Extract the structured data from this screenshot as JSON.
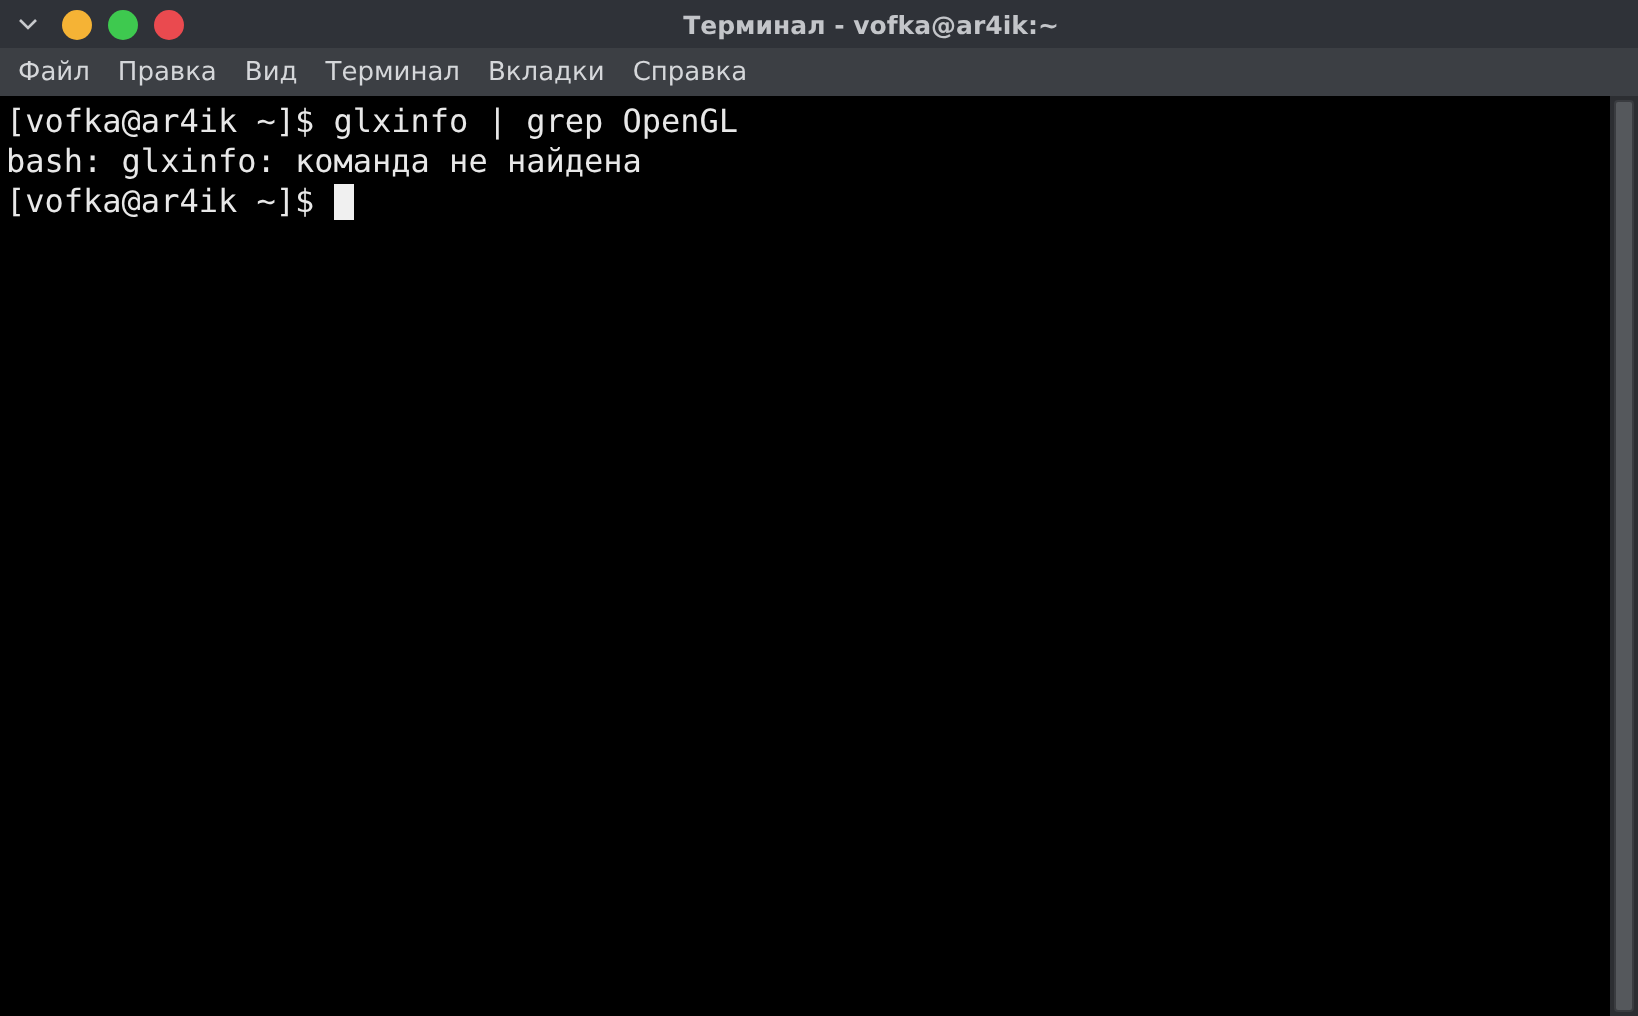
{
  "window": {
    "title": "Терминал - vofka@ar4ik:~"
  },
  "menu": [
    "Файл",
    "Правка",
    "Вид",
    "Терминал",
    "Вкладки",
    "Справка"
  ],
  "terminal": {
    "lines": [
      {
        "text": "[vofka@ar4ik ~]$ glxinfo | grep OpenGL",
        "cursor": false
      },
      {
        "text": "bash: glxinfo: команда не найдена",
        "cursor": false
      },
      {
        "text": "[vofka@ar4ik ~]$ ",
        "cursor": true
      }
    ]
  }
}
